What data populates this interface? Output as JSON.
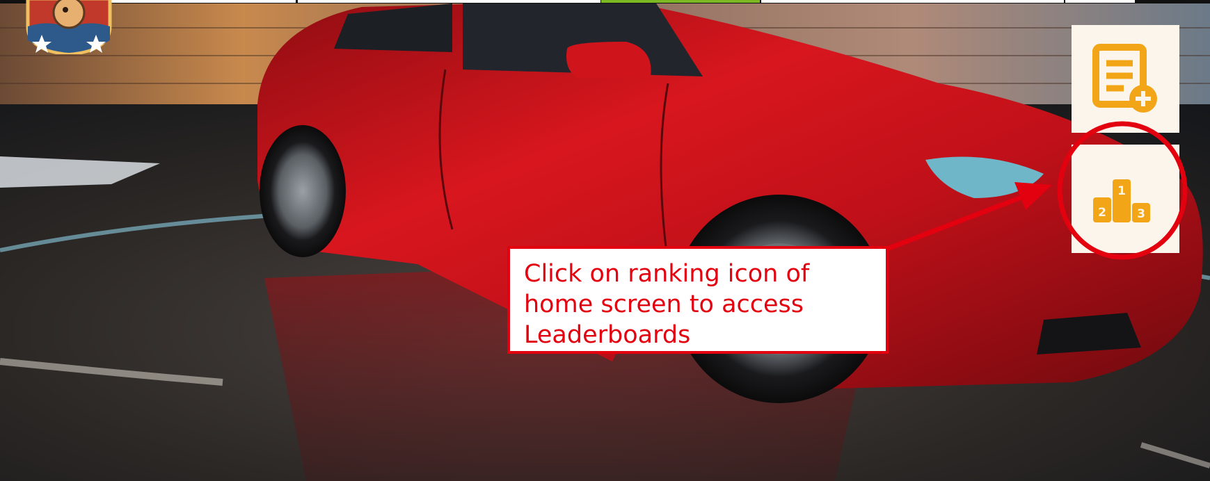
{
  "scene": {
    "description_icons": [
      "player-avatar-icon",
      "red-sedan-car"
    ]
  },
  "side_menu": {
    "items": [
      {
        "name": "task-list-add-icon",
        "color": "#f2a516"
      },
      {
        "name": "ranking-podium-icon",
        "color": "#f2a516",
        "podium_labels": [
          "2",
          "1",
          "3"
        ]
      }
    ]
  },
  "annotation": {
    "text": "Click on ranking icon of\nhome screen  to access\nLeaderboards",
    "color": "#e3000f"
  }
}
